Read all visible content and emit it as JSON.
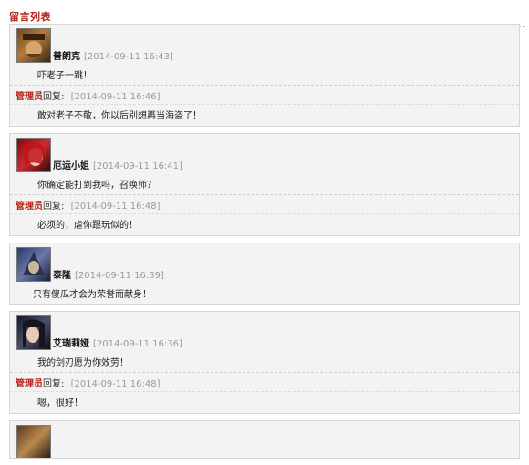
{
  "header": {
    "title": "留言列表"
  },
  "admin_label": "管理员",
  "reply_suffix": "回复:",
  "messages": [
    {
      "name": "普朗克",
      "time": "[2014-09-11 16:43]",
      "avatar_icon": "pirate-avatar-icon",
      "text": "吓老子一跳！",
      "reply": {
        "time": "[2014-09-11 16:46]",
        "text": "敢对老子不敬，你以后别想再当海盗了！"
      }
    },
    {
      "name": "厄运小姐",
      "time": "[2014-09-11 16:41]",
      "avatar_icon": "red-hair-avatar-icon",
      "text": "你确定能打到我吗，召唤师？",
      "reply": {
        "time": "[2014-09-11 16:48]",
        "text": "必须的，虐你跟玩似的！"
      }
    },
    {
      "name": "泰隆",
      "time": "[2014-09-11 16:39]",
      "avatar_icon": "hooded-avatar-icon",
      "text": "只有傻瓜才会为荣誉而献身！",
      "reply": null
    },
    {
      "name": "艾瑞莉娅",
      "time": "[2014-09-11 16:36]",
      "avatar_icon": "dark-hair-avatar-icon",
      "text": "我的剑刃愿为你效劳！",
      "reply": {
        "time": "[2014-09-11 16:48]",
        "text": "嗯，很好！"
      }
    }
  ]
}
